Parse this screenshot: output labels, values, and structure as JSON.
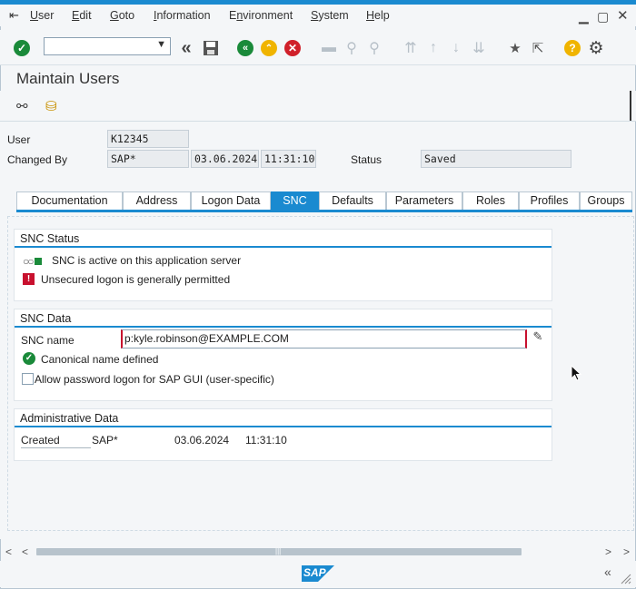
{
  "menu": {
    "items": [
      "User",
      "Edit",
      "Goto",
      "Information",
      "Environment",
      "System",
      "Help"
    ],
    "underline": [
      "U",
      "E",
      "G",
      "I",
      "n",
      "S",
      "H"
    ]
  },
  "toolbar": {
    "command_field_value": ""
  },
  "page": {
    "title": "Maintain Users"
  },
  "header": {
    "user_label": "User",
    "user_value": "K12345",
    "changed_by_label": "Changed By",
    "changed_by_value": "SAP*",
    "changed_date": "03.06.2024",
    "changed_time": "11:31:10",
    "status_label": "Status",
    "status_value": "Saved"
  },
  "tabs": [
    "Documentation",
    "Address",
    "Logon Data",
    "SNC",
    "Defaults",
    "Parameters",
    "Roles",
    "Profiles",
    "Groups"
  ],
  "active_tab": "SNC",
  "snc_status": {
    "title": "SNC Status",
    "active_text": "SNC is active on this application server",
    "unsecured_text": "Unsecured logon is generally permitted"
  },
  "snc_data": {
    "title": "SNC Data",
    "snc_name_label": "SNC name",
    "snc_name_value": "p:kyle.robinson@EXAMPLE.COM",
    "canonical_text": "Canonical name defined",
    "allow_password_label": "Allow password logon for SAP GUI (user-specific)",
    "allow_password_checked": false
  },
  "admin_data": {
    "title": "Administrative Data",
    "created_label": "Created",
    "created_by": "SAP*",
    "created_date": "03.06.2024",
    "created_time": "11:31:10"
  },
  "footer": {
    "logo_text": "SAP"
  },
  "colors": {
    "accent": "#1a8ad0",
    "ok_green": "#1a8a3a",
    "cancel_red": "#d0202a",
    "yellow": "#f0b400"
  }
}
